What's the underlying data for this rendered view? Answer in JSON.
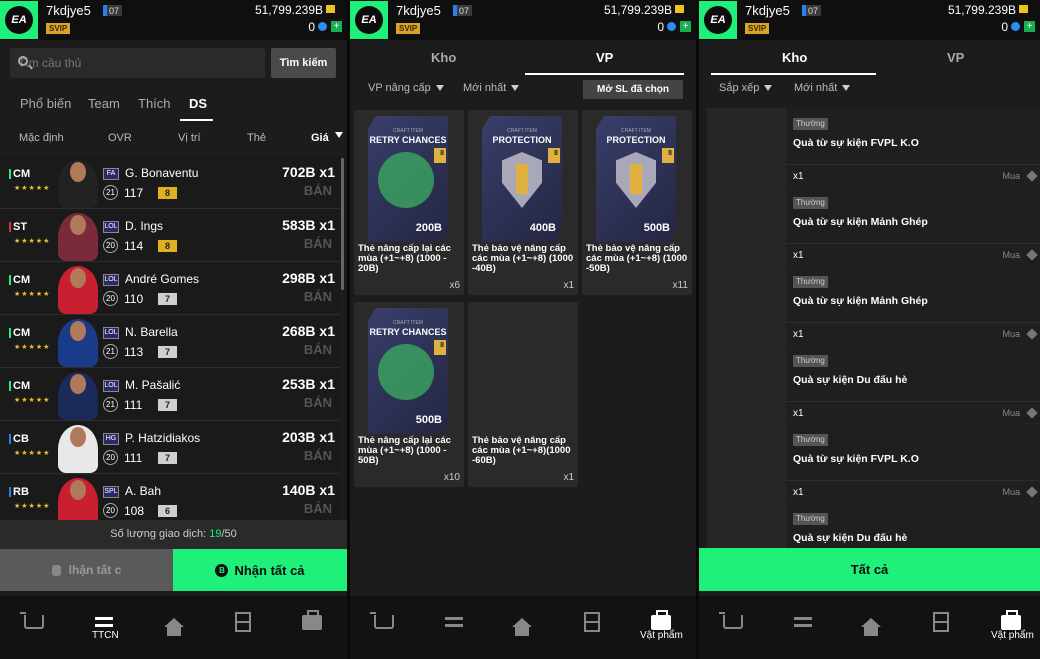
{
  "header": {
    "username": "7kdjye5",
    "level": "07",
    "vip": "SVIP",
    "coins": "51,799.239B",
    "points": "0"
  },
  "p1": {
    "search_placeholder": "Tìm cầu thủ",
    "search_button": "Tìm kiếm",
    "tabs": [
      "Phổ biến",
      "Team",
      "Thích",
      "DS"
    ],
    "sort": [
      "Mặc định",
      "OVR",
      "Vị trí",
      "Thẻ",
      "Giá"
    ],
    "players": [
      {
        "pos": "CM",
        "stars": "★★★★★",
        "season": "FA",
        "name": "G. Bonaventu",
        "ovr_circle": "21",
        "ovr": "117",
        "upgrade": "8",
        "price": "702B x1",
        "sell": "BÁN",
        "pos_color": "#1ef07a",
        "upgrade_color": "#e0b020",
        "kit": "#222"
      },
      {
        "pos": "ST",
        "stars": "★★★★★",
        "season": "LOL",
        "name": "D. Ings",
        "ovr_circle": "20",
        "ovr": "114",
        "upgrade": "8",
        "price": "583B x1",
        "sell": "BÁN",
        "pos_color": "#e03030",
        "upgrade_color": "#e0b020",
        "kit": "#7a2a3a"
      },
      {
        "pos": "CM",
        "stars": "★★★★★",
        "season": "LOL",
        "name": "André Gomes",
        "ovr_circle": "20",
        "ovr": "110",
        "upgrade": "7",
        "price": "298B x1",
        "sell": "BÁN",
        "pos_color": "#1ef07a",
        "upgrade_color": "#cfcfcf",
        "kit": "#c82030"
      },
      {
        "pos": "CM",
        "stars": "★★★★★",
        "season": "LOL",
        "name": "N. Barella",
        "ovr_circle": "21",
        "ovr": "113",
        "upgrade": "7",
        "price": "268B x1",
        "sell": "BÁN",
        "pos_color": "#1ef07a",
        "upgrade_color": "#cfcfcf",
        "kit": "#1a3a8a"
      },
      {
        "pos": "CM",
        "stars": "★★★★★",
        "season": "LOL",
        "name": "M. Pašalić",
        "ovr_circle": "21",
        "ovr": "111",
        "upgrade": "7",
        "price": "253B x1",
        "sell": "BÁN",
        "pos_color": "#1ef07a",
        "upgrade_color": "#cfcfcf",
        "kit": "#1a2a5a"
      },
      {
        "pos": "CB",
        "stars": "★★★★★",
        "season": "HG",
        "name": "P. Hatzidiakos",
        "ovr_circle": "20",
        "ovr": "111",
        "upgrade": "7",
        "price": "203B x1",
        "sell": "BÁN",
        "pos_color": "#2a7ff0",
        "upgrade_color": "#cfcfcf",
        "kit": "#e8e8e8"
      },
      {
        "pos": "RB",
        "stars": "★★★★★",
        "season": "SPL",
        "name": "A. Bah",
        "ovr_circle": "20",
        "ovr": "108",
        "upgrade": "6",
        "price": "140B x1",
        "sell": "BÁN",
        "pos_color": "#2a7ff0",
        "upgrade_color": "#cfcfcf",
        "kit": "#c82030"
      }
    ],
    "trades_label": "Số lượng giao dịch: ",
    "trades_used": "19",
    "trades_total": "/50",
    "claim_label": "lhận tất c",
    "claim_all_label": "Nhận tất cả",
    "claim_all_icon": "B"
  },
  "p2": {
    "tabs": [
      "Kho",
      "VP"
    ],
    "filters": [
      "VP nâng cấp",
      "Mới nhất"
    ],
    "select_button": "Mở SL đã chọn",
    "cards": [
      {
        "small": "CRAFT ITEM",
        "title": "RETRY CHANCES",
        "value": "200B",
        "badge": "8",
        "desc": "Thẻ nâng cấp lại các mùa (+1~+8) (1000 - 20B)",
        "qty": "x6",
        "kind": "retry"
      },
      {
        "small": "CRAFT ITEM",
        "title": "PROTECTION",
        "value": "400B",
        "badge": "8",
        "desc": "Thẻ bảo vệ nâng cấp các mùa (+1~+8) (1000 -40B)",
        "qty": "x1",
        "kind": "protect"
      },
      {
        "small": "CRAFT ITEM",
        "title": "PROTECTION",
        "value": "500B",
        "badge": "8",
        "desc": "Thẻ bảo vệ nâng cấp các mùa (+1~+8) (1000 -50B)",
        "qty": "x11",
        "kind": "protect"
      },
      {
        "small": "CRAFT ITEM",
        "title": "RETRY CHANCES",
        "value": "500B",
        "badge": "8",
        "desc": "Thẻ nâng cấp lại các mùa (+1~+8) (1000 - 50B)",
        "qty": "x10",
        "kind": "retry"
      },
      {
        "small": "",
        "title": "",
        "value": "",
        "badge": "",
        "desc": "Thẻ bảo vệ nâng cấp các mùa (+1~+8)(1000 -60B)",
        "qty": "x1",
        "kind": "empty"
      }
    ]
  },
  "p3": {
    "tabs": [
      "Kho",
      "VP"
    ],
    "filters": [
      "Sắp xếp",
      "Mới nhất"
    ],
    "items": [
      {
        "tag": "Thường",
        "title": "Quà từ sự kiện FVPL K.O",
        "qty": "x1",
        "buy": "Mua"
      },
      {
        "tag": "Thường",
        "title": "Quà từ sự kiện Mảnh Ghép",
        "qty": "x1",
        "buy": "Mua"
      },
      {
        "tag": "Thường",
        "title": "Quà từ sự kiện Mảnh Ghép",
        "qty": "x1",
        "buy": "Mua"
      },
      {
        "tag": "Thường",
        "title": "Quà sự kiện Du đấu hè",
        "qty": "x1",
        "buy": "Mua"
      },
      {
        "tag": "Thường",
        "title": "Quà từ sự kiện FVPL K.O",
        "qty": "x1",
        "buy": "Mua"
      },
      {
        "tag": "Thường",
        "title": "Quà sự kiện Du đấu hè",
        "qty": "",
        "buy": ""
      }
    ],
    "all_button": "Tất cả"
  },
  "nav": {
    "ttcn": "TTCN",
    "vatpham": "Vật phẩm"
  },
  "icons": {
    "cart": "cart-icon",
    "transfer": "transfer-icon",
    "home": "home-icon",
    "pitch": "pitch-icon",
    "bag": "bag-icon"
  }
}
